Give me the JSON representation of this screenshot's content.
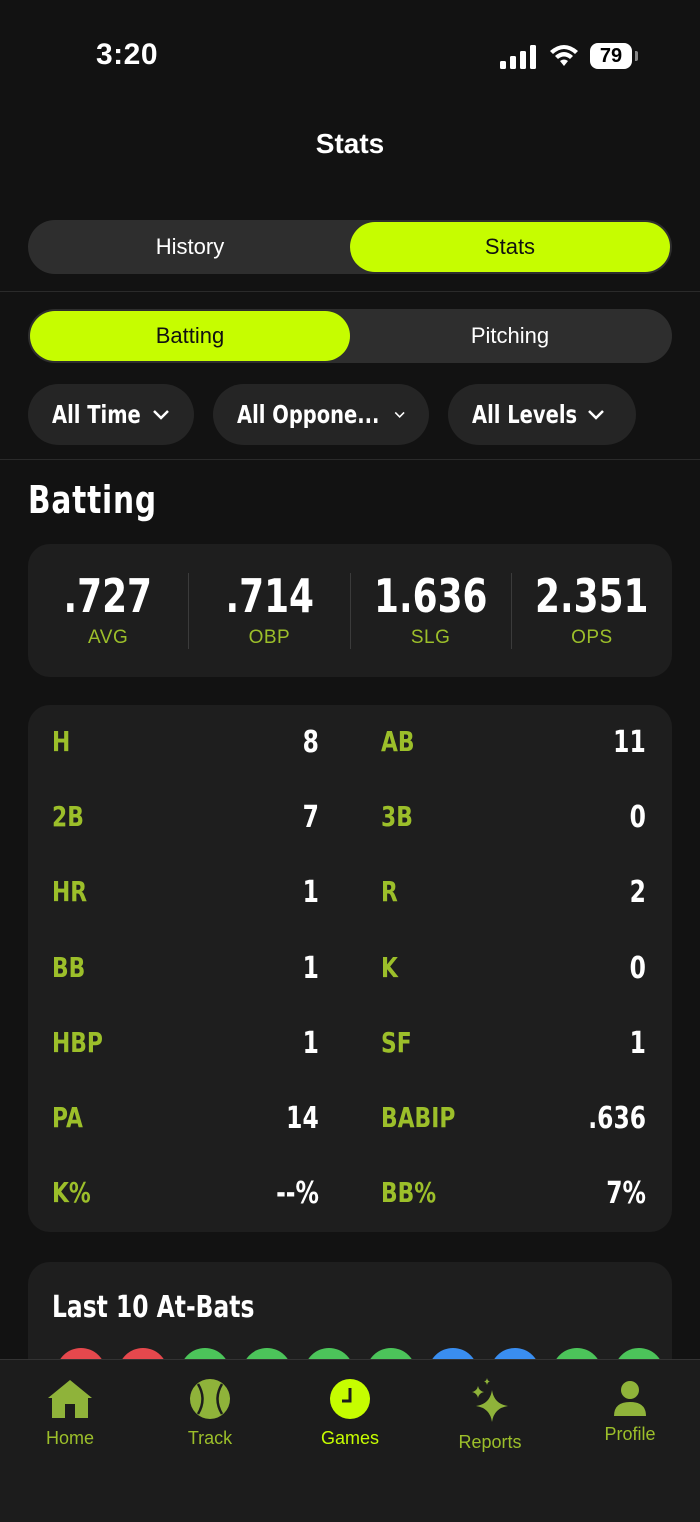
{
  "status": {
    "time": "3:20",
    "battery": "79"
  },
  "page_title": "Stats",
  "top_tabs": {
    "history": "History",
    "stats": "Stats"
  },
  "sub_tabs": {
    "batting": "Batting",
    "pitching": "Pitching"
  },
  "filters": {
    "time": "All Time",
    "opponents": "All Oppone...",
    "levels": "All Levels"
  },
  "section_title": "Batting",
  "summary": [
    {
      "value": ".727",
      "label": "AVG"
    },
    {
      "value": ".714",
      "label": "OBP"
    },
    {
      "value": "1.636",
      "label": "SLG"
    },
    {
      "value": "2.351",
      "label": "OPS"
    }
  ],
  "counts": [
    {
      "l_label": "H",
      "l_value": "8",
      "r_label": "AB",
      "r_value": "11"
    },
    {
      "l_label": "2B",
      "l_value": "7",
      "r_label": "3B",
      "r_value": "0"
    },
    {
      "l_label": "HR",
      "l_value": "1",
      "r_label": "R",
      "r_value": "2"
    },
    {
      "l_label": "BB",
      "l_value": "1",
      "r_label": "K",
      "r_value": "0"
    },
    {
      "l_label": "HBP",
      "l_value": "1",
      "r_label": "SF",
      "r_value": "1"
    },
    {
      "l_label": "PA",
      "l_value": "14",
      "r_label": "BABIP",
      "r_value": ".636"
    },
    {
      "l_label": "K%",
      "l_value": "--%",
      "r_label": "BB%",
      "r_value": "7%"
    }
  ],
  "last10": {
    "title": "Last 10 At-Bats",
    "results_colors": [
      "#e5484d",
      "#e5484d",
      "#4cc45a",
      "#4cc45a",
      "#4cc45a",
      "#4cc45a",
      "#3a8ef0",
      "#3a8ef0",
      "#4cc45a",
      "#4cc45a"
    ]
  },
  "tab_bar": {
    "home": "Home",
    "track": "Track",
    "games": "Games",
    "reports": "Reports",
    "profile": "Profile"
  },
  "colors": {
    "accent": "#c6fd00",
    "label_green": "#9cbf2a",
    "background": "#121212",
    "card": "#1e1e1e"
  }
}
